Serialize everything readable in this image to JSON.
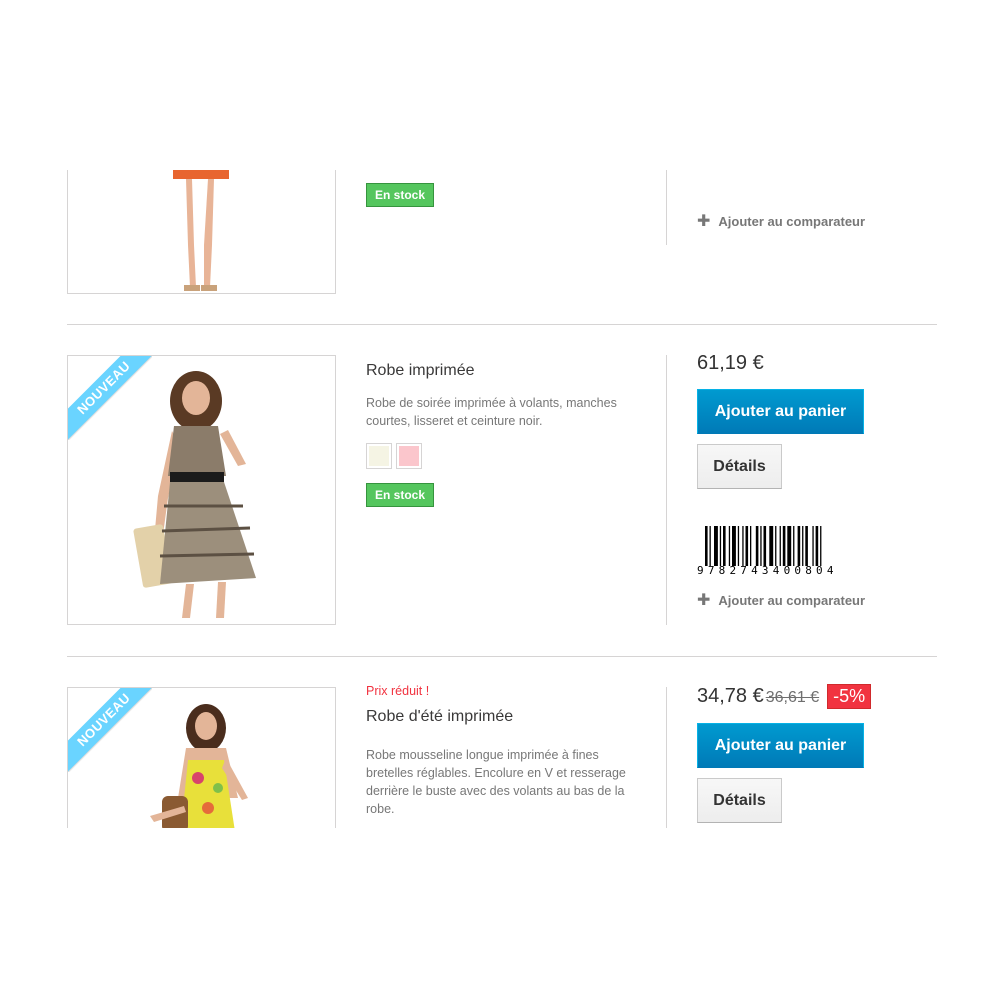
{
  "products": [
    {
      "stock_label": "En stock",
      "compare_label": "Ajouter au comparateur"
    },
    {
      "badge": "Nouveau",
      "name": "Robe imprimée",
      "description": "Robe de soirée imprimée à volants, manches courtes, lisseret et ceinture noir.",
      "swatches": [
        "#f5f4e4",
        "#fbc6cc"
      ],
      "stock_label": "En stock",
      "price": "61,19 €",
      "add_to_cart_label": "Ajouter au panier",
      "details_label": "Détails",
      "barcode_number": "9782743400804",
      "compare_label": "Ajouter au comparateur"
    },
    {
      "badge": "Nouveau",
      "reduced_label": "Prix réduit !",
      "name": "Robe d'été imprimée",
      "description": "Robe mousseline longue imprimée à fines bretelles réglables. Encolure en V et resserage derrière le buste avec des volants au bas de la robe.",
      "price": "34,78 €",
      "old_price": "36,61 €",
      "discount": "-5%",
      "add_to_cart_label": "Ajouter au panier",
      "details_label": "Détails"
    }
  ],
  "colors": {
    "stock_green": "#55c65e",
    "cart_blue": "#009ad0",
    "badge_blue": "#6ad4ff",
    "discount_red": "#f13340"
  }
}
